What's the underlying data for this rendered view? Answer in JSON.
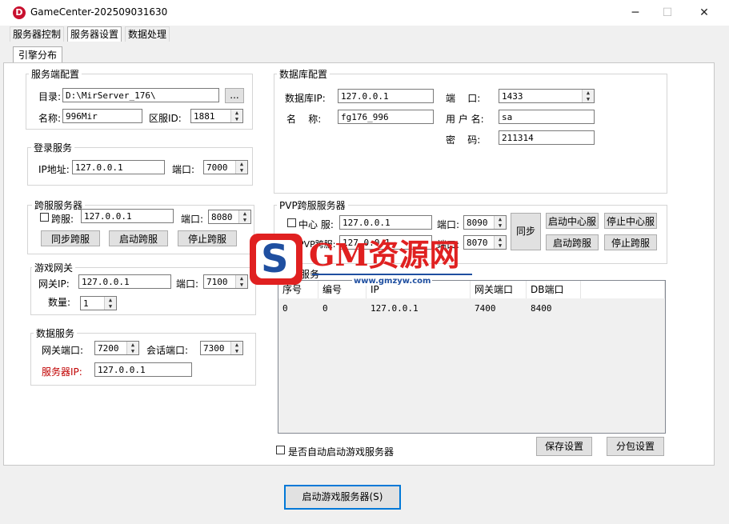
{
  "window": {
    "title": "GameCenter-202509031630",
    "icon_letter": "D"
  },
  "menu_tabs": [
    "服务器控制",
    "服务器设置",
    "数据处理"
  ],
  "sub_tab": "引擎分布",
  "server_config": {
    "title": "服务端配置",
    "dir_label": "目录:",
    "dir_value": "D:\\MirServer_176\\",
    "browse": "...",
    "name_label": "名称:",
    "name_value": "996Mir",
    "zone_label": "区服ID:",
    "zone_value": "1881"
  },
  "login_service": {
    "title": "登录服务",
    "ip_label": "IP地址:",
    "ip_value": "127.0.0.1",
    "port_label": "端口:",
    "port_value": "7000"
  },
  "cross_server": {
    "title": "跨服服务器",
    "check_label": "跨服:",
    "ip_value": "127.0.0.1",
    "port_label": "端口:",
    "port_value": "8080",
    "buttons": [
      "同步跨服",
      "启动跨服",
      "停止跨服"
    ]
  },
  "game_gateway": {
    "title": "游戏网关",
    "ip_label": "网关IP:",
    "ip_value": "127.0.0.1",
    "port_label": "端口:",
    "port_value": "7100",
    "count_label": "数量:",
    "count_value": "1"
  },
  "data_service": {
    "title": "数据服务",
    "gw_port_label": "网关端口:",
    "gw_port_value": "7200",
    "session_port_label": "会话端口:",
    "session_port_value": "7300",
    "server_ip_label": "服务器IP:",
    "server_ip_value": "127.0.0.1",
    "server_ip_color": "#c00000"
  },
  "database": {
    "title": "数据库配置",
    "ip_label": "数据库IP:",
    "ip_value": "127.0.0.1",
    "name_label": "名    称:",
    "name_value": "fg176_996",
    "port_label": "端    口:",
    "port_value": "1433",
    "user_label": "用 户 名:",
    "user_value": "sa",
    "pwd_label": "密    码:",
    "pwd_value": "211314"
  },
  "pvp_server": {
    "title": "PVP跨服服务器",
    "center_label": "中心 服:",
    "center_ip": "127.0.0.1",
    "center_port_label": "端口:",
    "center_port": "8090",
    "pvp_label": "PVP跨服:",
    "pvp_ip": "127.0.0.1",
    "pvp_port_label": "端口:",
    "pvp_port": "8070",
    "sync_button": "同步",
    "buttons": [
      "启动中心服",
      "停止中心服",
      "启动跨服",
      "停止跨服"
    ]
  },
  "engine_service": {
    "title": "引擎服务",
    "columns": [
      "序号",
      "编号",
      "IP",
      "网关端口",
      "DB端口"
    ],
    "rows": [
      [
        "0",
        "0",
        "127.0.0.1",
        "7400",
        "8400"
      ]
    ]
  },
  "auto_start_label": "是否自动启动游戏服务器",
  "save_button": "保存设置",
  "split_button": "分包设置",
  "start_button": "启动游戏服务器(S)",
  "watermark": {
    "brand": "GM资源网",
    "url": "www.gmzyw.com",
    "logo_letter": "S"
  },
  "colors": {
    "accent": "#0078d7",
    "brand_red": "#e02020",
    "brand_blue": "#1f4fa0"
  }
}
